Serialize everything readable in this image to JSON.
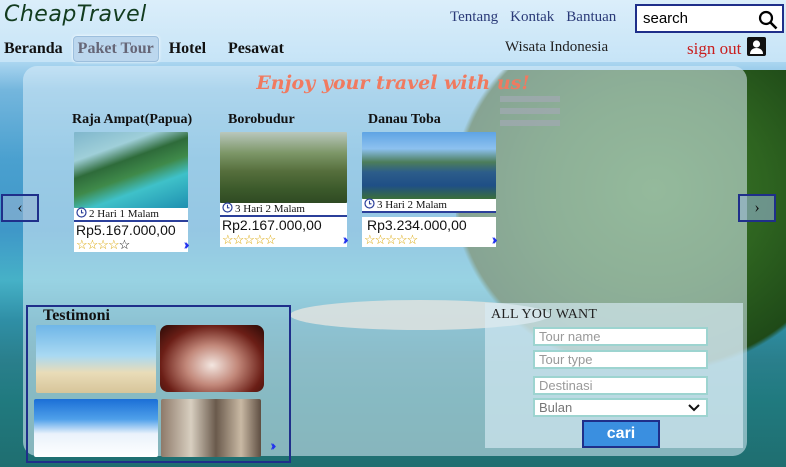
{
  "app": {
    "logo": "CheapTravel"
  },
  "topnav": [
    "Tentang",
    "Kontak",
    "Bantuan"
  ],
  "search": {
    "value": "search"
  },
  "mainnav": [
    {
      "label": "Beranda",
      "active": false
    },
    {
      "label": "Paket Tour",
      "active": true
    },
    {
      "label": "Hotel",
      "active": false
    },
    {
      "label": "Pesawat",
      "active": false
    }
  ],
  "wisata_label": "Wisata Indonesia",
  "signout_label": "sign out",
  "tagline": "Enjoy your travel with us!",
  "carousel": {
    "prev": "‹",
    "next": "›"
  },
  "tours": [
    {
      "title": "Raja Ampat(Papua)",
      "duration": "2 Hari 1 Malam",
      "price": "Rp5.167.000,00",
      "rating": 0
    },
    {
      "title": "Borobudur",
      "duration": "3 Hari 2 Malam",
      "price": "Rp2.167.000,00",
      "rating": 0
    },
    {
      "title": "Danau Toba",
      "duration": "3 Hari 2 Malam",
      "price": "Rp3.234.000,00",
      "rating": 0
    }
  ],
  "testimoni": {
    "title": "Testimoni"
  },
  "form": {
    "title": "ALL YOU WANT",
    "tour_name_placeholder": "Tour name",
    "tour_type_placeholder": "Tour type",
    "destinasi_placeholder": "Destinasi",
    "bulan_value": "Bulan",
    "submit_label": "cari"
  },
  "colors": {
    "brand_dark": "#1f2f8a",
    "accent_red": "#c91e1e",
    "tagline": "#f07a60",
    "button": "#3a8fe0"
  }
}
